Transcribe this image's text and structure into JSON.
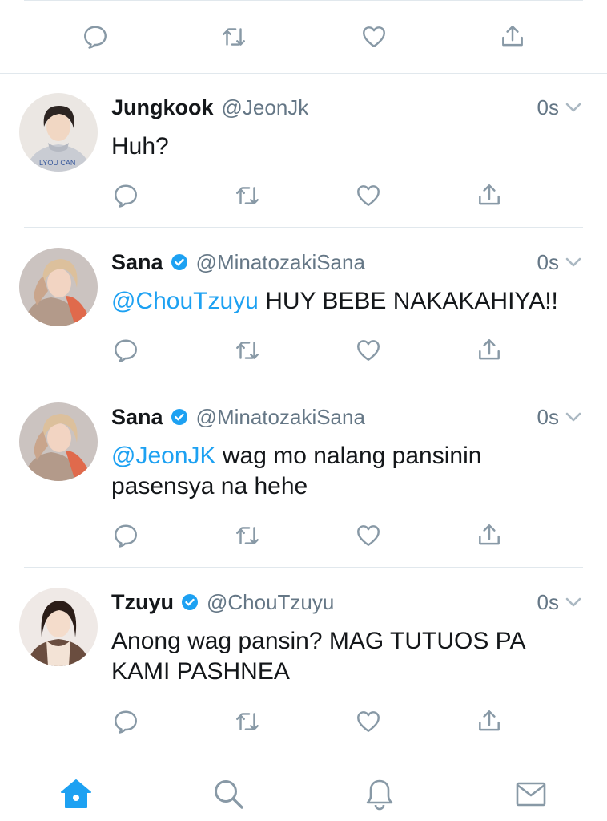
{
  "accent_color": "#1da1f2",
  "icon_color": "#8899a6",
  "action_icons": [
    "reply-icon",
    "retweet-icon",
    "like-icon",
    "share-icon"
  ],
  "tweets": [
    {
      "name": "Jungkook",
      "handle": "@JeonJk",
      "verified": false,
      "time": "0s",
      "mention": "",
      "text": "Huh?"
    },
    {
      "name": "Sana",
      "handle": "@MinatozakiSana",
      "verified": true,
      "time": "0s",
      "mention": "@ChouTzuyu",
      "text": " HUY BEBE NAKAKAHIYA!!"
    },
    {
      "name": "Sana",
      "handle": "@MinatozakiSana",
      "verified": true,
      "time": "0s",
      "mention": "@JeonJK",
      "text": " wag mo nalang pansinin pasensya na hehe"
    },
    {
      "name": "Tzuyu",
      "handle": "@ChouTzuyu",
      "verified": true,
      "time": "0s",
      "mention": "",
      "text": "Anong wag pansin? MAG TUTUOS PA KAMI PASHNEA"
    }
  ],
  "tabbar": {
    "active_tab": "home",
    "tabs": [
      "home-icon",
      "search-icon",
      "notifications-icon",
      "messages-icon"
    ]
  }
}
